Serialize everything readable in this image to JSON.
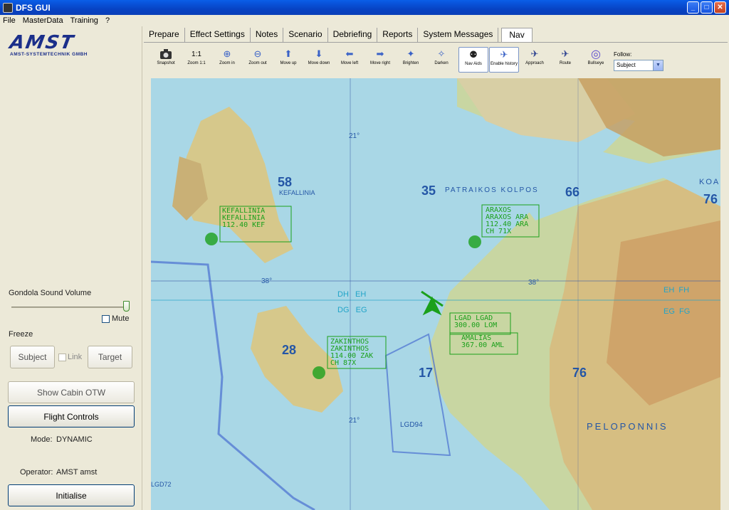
{
  "window": {
    "title": "DFS GUI",
    "min": "_",
    "max": "□",
    "close": "✕"
  },
  "menu": [
    "File",
    "MasterData",
    "Training",
    "?"
  ],
  "logo": {
    "name": "AMST",
    "subtitle": "AMST-SYSTEMTECHNIK GMBH"
  },
  "left": {
    "volume_label": "Gondola Sound Volume",
    "mute_label": "Mute",
    "freeze_label": "Freeze",
    "subject_btn": "Subject",
    "link_label": "Link",
    "target_btn": "Target",
    "show_cabin_btn": "Show Cabin OTW",
    "flight_controls_btn": "Flight Controls",
    "mode_label": "Mode:",
    "mode_value": "DYNAMIC",
    "operator_label": "Operator:",
    "operator_value": "AMST amst",
    "initialise_btn": "Initialise"
  },
  "tabs": [
    "Prepare",
    "Effect Settings",
    "Notes",
    "Scenario",
    "Debriefing",
    "Reports",
    "System Messages",
    "Nav"
  ],
  "toolbar": [
    {
      "label": "Snapshot",
      "icon": "camera-icon"
    },
    {
      "label": "Zoom 1:1",
      "icon": "zoom-reset-icon",
      "glyph": "1:1"
    },
    {
      "label": "Zoom in",
      "icon": "zoom-in-icon",
      "glyph": "⊕"
    },
    {
      "label": "Zoom out",
      "icon": "zoom-out-icon",
      "glyph": "⊖"
    },
    {
      "label": "Move up",
      "icon": "arrow-up-icon",
      "glyph": "⬆"
    },
    {
      "label": "Move down",
      "icon": "arrow-down-icon",
      "glyph": "⬇"
    },
    {
      "label": "Move left",
      "icon": "arrow-left-icon",
      "glyph": "⬅"
    },
    {
      "label": "Move right",
      "icon": "arrow-right-icon",
      "glyph": "➡"
    },
    {
      "label": "Brighten",
      "icon": "brighten-icon",
      "glyph": "✦"
    },
    {
      "label": "Darken",
      "icon": "darken-icon",
      "glyph": "✧"
    },
    {
      "label": "Nav Aids",
      "icon": "nav-aids-icon",
      "glyph": "⚉"
    },
    {
      "label": "Enable history",
      "icon": "history-icon",
      "glyph": "✈"
    },
    {
      "label": "Approach",
      "icon": "approach-icon",
      "glyph": "✈"
    },
    {
      "label": "Route",
      "icon": "route-icon",
      "glyph": "✈"
    },
    {
      "label": "Bullseye",
      "icon": "bullseye-icon",
      "glyph": "◎"
    }
  ],
  "follow": {
    "label": "Follow:",
    "value": "Subject"
  },
  "map": {
    "labels": [
      {
        "text": "KEFALLINIA\nKEFALLINIA\n112.40 KEF"
      },
      {
        "text": "ARAXOS\nARAXOS ARA\n112.40 ARA\nCH 71X"
      },
      {
        "text": "LGAD LGAD\n300.00 LOM"
      },
      {
        "text": "AMALIAS\n367.00 AML"
      },
      {
        "text": "ZAKINTHOS\nZAKINTHOS\n114.00 ZAK\nCH 87X"
      }
    ],
    "texts": {
      "kefalinia": "KEFALLINIA",
      "patraikos": "PATRAIKOS KOLPOS",
      "peloponnisos": "PELOPONNIS",
      "lgd94": "LGD94",
      "lgd72": "LGD72",
      "dh_eh": "DH   EH",
      "dg_eg": "DG   EG",
      "eh_fh": "EH  FH",
      "eg_fg": "EG  FG",
      "grid_58": "58",
      "grid_35": "35",
      "grid_66": "66",
      "grid_76": "76",
      "grid_28": "28",
      "grid_17": "17",
      "grid_76b": "76",
      "lat_38": "38°",
      "lat_38b": "38°",
      "lon_21": "21°",
      "lon_21b": "21°",
      "koa": "KOA"
    }
  }
}
